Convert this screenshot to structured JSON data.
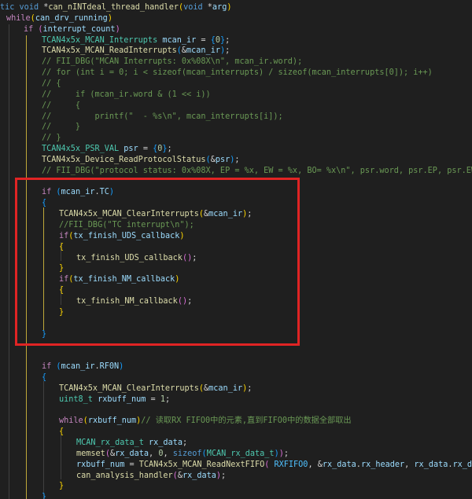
{
  "editor": {
    "language": "c",
    "theme": "dark",
    "highlight_box_color": "#e02424",
    "lines": [
      [
        {
          "t": "tic ",
          "c": "kw"
        },
        {
          "t": "void ",
          "c": "kw"
        },
        {
          "t": "*",
          "c": "op"
        },
        {
          "t": "can_nINTdeal_thread_handler",
          "c": "fn"
        },
        {
          "t": "(",
          "c": "br1"
        },
        {
          "t": "void ",
          "c": "kw"
        },
        {
          "t": "*",
          "c": "op"
        },
        {
          "t": "arg",
          "c": "var"
        },
        {
          "t": ")",
          "c": "br1"
        }
      ],
      [
        {
          "t": "while",
          "c": "ctl"
        },
        {
          "t": "(",
          "c": "br1"
        },
        {
          "t": "can_drv_running",
          "c": "var"
        },
        {
          "t": ")",
          "c": "br1"
        }
      ],
      [
        {
          "t": "if ",
          "c": "ctl"
        },
        {
          "t": "(",
          "c": "br2"
        },
        {
          "t": "interrupt_count",
          "c": "var"
        },
        {
          "t": ")",
          "c": "br2"
        }
      ],
      [
        {
          "t": "TCAN4x5x_MCAN_Interrupts ",
          "c": "type"
        },
        {
          "t": "mcan_ir ",
          "c": "var"
        },
        {
          "t": "= ",
          "c": "op"
        },
        {
          "t": "{",
          "c": "br3"
        },
        {
          "t": "0",
          "c": "num"
        },
        {
          "t": "}",
          "c": "br3"
        },
        {
          "t": ";",
          "c": "op"
        }
      ],
      [
        {
          "t": "TCAN4x5x_MCAN_ReadInterrupts",
          "c": "fn"
        },
        {
          "t": "(",
          "c": "br3"
        },
        {
          "t": "&",
          "c": "op"
        },
        {
          "t": "mcan_ir",
          "c": "var"
        },
        {
          "t": ")",
          "c": "br3"
        },
        {
          "t": ";",
          "c": "op"
        }
      ],
      [
        {
          "t": "// FII_DBG(\"MCAN Interrupts: 0x%08X\\n\", mcan_ir.word);",
          "c": "cmt"
        }
      ],
      [
        {
          "t": "// for (int i = 0; i < sizeof(mcan_interrupts) / sizeof(mcan_interrupts[0]); i++)",
          "c": "cmt"
        }
      ],
      [
        {
          "t": "// {",
          "c": "cmt"
        }
      ],
      [
        {
          "t": "//     if (mcan_ir.word & (1 << i))",
          "c": "cmt"
        }
      ],
      [
        {
          "t": "//     {",
          "c": "cmt"
        }
      ],
      [
        {
          "t": "//         printf(\"  - %s\\n\", mcan_interrupts[i]);",
          "c": "cmt"
        }
      ],
      [
        {
          "t": "//     }",
          "c": "cmt"
        }
      ],
      [
        {
          "t": "// }",
          "c": "cmt"
        }
      ],
      [
        {
          "t": "TCAN4x5x_PSR_VAL ",
          "c": "type"
        },
        {
          "t": "psr ",
          "c": "var"
        },
        {
          "t": "= ",
          "c": "op"
        },
        {
          "t": "{",
          "c": "br3"
        },
        {
          "t": "0",
          "c": "num"
        },
        {
          "t": "}",
          "c": "br3"
        },
        {
          "t": ";",
          "c": "op"
        }
      ],
      [
        {
          "t": "TCAN4x5x_Device_ReadProtocolStatus",
          "c": "fn"
        },
        {
          "t": "(",
          "c": "br3"
        },
        {
          "t": "&",
          "c": "op"
        },
        {
          "t": "psr",
          "c": "var"
        },
        {
          "t": ")",
          "c": "br3"
        },
        {
          "t": ";",
          "c": "op"
        }
      ],
      [
        {
          "t": "// FII_DBG(\"protocol status: 0x%08X, EP = %x, EW = %x, BO= %x\\n\", psr.word, psr.EP, psr.EW, psr.BO",
          "c": "cmt"
        }
      ],
      [],
      [
        {
          "t": "if ",
          "c": "ctl"
        },
        {
          "t": "(",
          "c": "br3"
        },
        {
          "t": "mcan_ir",
          "c": "var"
        },
        {
          "t": ".",
          "c": "op"
        },
        {
          "t": "TC",
          "c": "var"
        },
        {
          "t": ")",
          "c": "br3"
        }
      ],
      [
        {
          "t": "{",
          "c": "br3"
        }
      ],
      [
        {
          "t": "TCAN4x5x_MCAN_ClearInterrupts",
          "c": "fn"
        },
        {
          "t": "(",
          "c": "br1"
        },
        {
          "t": "&",
          "c": "op"
        },
        {
          "t": "mcan_ir",
          "c": "var"
        },
        {
          "t": ")",
          "c": "br1"
        },
        {
          "t": ";",
          "c": "op"
        }
      ],
      [
        {
          "t": "//FII_DBG(\"TC interrupt\\n\");",
          "c": "cmt"
        }
      ],
      [
        {
          "t": "if",
          "c": "ctl"
        },
        {
          "t": "(",
          "c": "br1"
        },
        {
          "t": "tx_finish_UDS_callback",
          "c": "var"
        },
        {
          "t": ")",
          "c": "br1"
        }
      ],
      [
        {
          "t": "{",
          "c": "br1"
        }
      ],
      [
        {
          "t": "tx_finish_UDS_callback",
          "c": "fn"
        },
        {
          "t": "(",
          "c": "br2"
        },
        {
          "t": ")",
          "c": "br2"
        },
        {
          "t": ";",
          "c": "op"
        }
      ],
      [
        {
          "t": "}",
          "c": "br1"
        }
      ],
      [
        {
          "t": "if",
          "c": "ctl"
        },
        {
          "t": "(",
          "c": "br1"
        },
        {
          "t": "tx_finish_NM_callback",
          "c": "var"
        },
        {
          "t": ")",
          "c": "br1"
        }
      ],
      [
        {
          "t": "{",
          "c": "br1"
        }
      ],
      [
        {
          "t": "tx_finish_NM_callback",
          "c": "fn"
        },
        {
          "t": "(",
          "c": "br2"
        },
        {
          "t": ")",
          "c": "br2"
        },
        {
          "t": ";",
          "c": "op"
        }
      ],
      [
        {
          "t": "}",
          "c": "br1"
        }
      ],
      [],
      [
        {
          "t": "}",
          "c": "br3"
        }
      ],
      [],
      [],
      [
        {
          "t": "if ",
          "c": "ctl"
        },
        {
          "t": "(",
          "c": "br3"
        },
        {
          "t": "mcan_ir",
          "c": "var"
        },
        {
          "t": ".",
          "c": "op"
        },
        {
          "t": "RF0N",
          "c": "var"
        },
        {
          "t": ")",
          "c": "br3"
        }
      ],
      [
        {
          "t": "{",
          "c": "br3"
        }
      ],
      [
        {
          "t": "TCAN4x5x_MCAN_ClearInterrupts",
          "c": "fn"
        },
        {
          "t": "(",
          "c": "br1"
        },
        {
          "t": "&",
          "c": "op"
        },
        {
          "t": "mcan_ir",
          "c": "var"
        },
        {
          "t": ")",
          "c": "br1"
        },
        {
          "t": ";",
          "c": "op"
        }
      ],
      [
        {
          "t": "uint8_t ",
          "c": "type"
        },
        {
          "t": "rxbuff_num ",
          "c": "var"
        },
        {
          "t": "= ",
          "c": "op"
        },
        {
          "t": "1",
          "c": "num"
        },
        {
          "t": ";",
          "c": "op"
        }
      ],
      [],
      [
        {
          "t": "while",
          "c": "ctl"
        },
        {
          "t": "(",
          "c": "br1"
        },
        {
          "t": "rxbuff_num",
          "c": "var"
        },
        {
          "t": ")",
          "c": "br1"
        },
        {
          "t": "// 读取RX FIFO0中的元素,直到FIFO0中的数据全部取出",
          "c": "cmt"
        }
      ],
      [
        {
          "t": "{",
          "c": "br1"
        }
      ],
      [
        {
          "t": "MCAN_rx_data_t ",
          "c": "type"
        },
        {
          "t": "rx_data",
          "c": "var"
        },
        {
          "t": ";",
          "c": "op"
        }
      ],
      [
        {
          "t": "memset",
          "c": "fn"
        },
        {
          "t": "(",
          "c": "br2"
        },
        {
          "t": "&",
          "c": "op"
        },
        {
          "t": "rx_data",
          "c": "var"
        },
        {
          "t": ", ",
          "c": "op"
        },
        {
          "t": "0",
          "c": "num"
        },
        {
          "t": ", ",
          "c": "op"
        },
        {
          "t": "sizeof",
          "c": "kw"
        },
        {
          "t": "(",
          "c": "br3"
        },
        {
          "t": "MCAN_rx_data_t",
          "c": "type"
        },
        {
          "t": ")",
          "c": "br3"
        },
        {
          "t": ")",
          "c": "br2"
        },
        {
          "t": ";",
          "c": "op"
        }
      ],
      [
        {
          "t": "rxbuff_num ",
          "c": "var"
        },
        {
          "t": "= ",
          "c": "op"
        },
        {
          "t": "TCAN4x5x_MCAN_ReadNextFIFO",
          "c": "fn"
        },
        {
          "t": "( ",
          "c": "br2"
        },
        {
          "t": "RXFIFO0",
          "c": "macro"
        },
        {
          "t": ", ",
          "c": "op"
        },
        {
          "t": "&",
          "c": "op"
        },
        {
          "t": "rx_data",
          "c": "var"
        },
        {
          "t": ".",
          "c": "op"
        },
        {
          "t": "rx_header",
          "c": "var"
        },
        {
          "t": ", ",
          "c": "op"
        },
        {
          "t": "rx_data",
          "c": "var"
        },
        {
          "t": ".",
          "c": "op"
        },
        {
          "t": "rx_data_buf",
          "c": "var"
        },
        {
          "t": ",",
          "c": "op"
        }
      ],
      [
        {
          "t": "can_analysis_handler",
          "c": "fn"
        },
        {
          "t": "(",
          "c": "br2"
        },
        {
          "t": "&",
          "c": "op"
        },
        {
          "t": "rx_data",
          "c": "var"
        },
        {
          "t": ")",
          "c": "br2"
        },
        {
          "t": ";",
          "c": "op"
        }
      ],
      [
        {
          "t": "}",
          "c": "br1"
        }
      ],
      [
        {
          "t": "}",
          "c": "br3"
        }
      ]
    ]
  }
}
